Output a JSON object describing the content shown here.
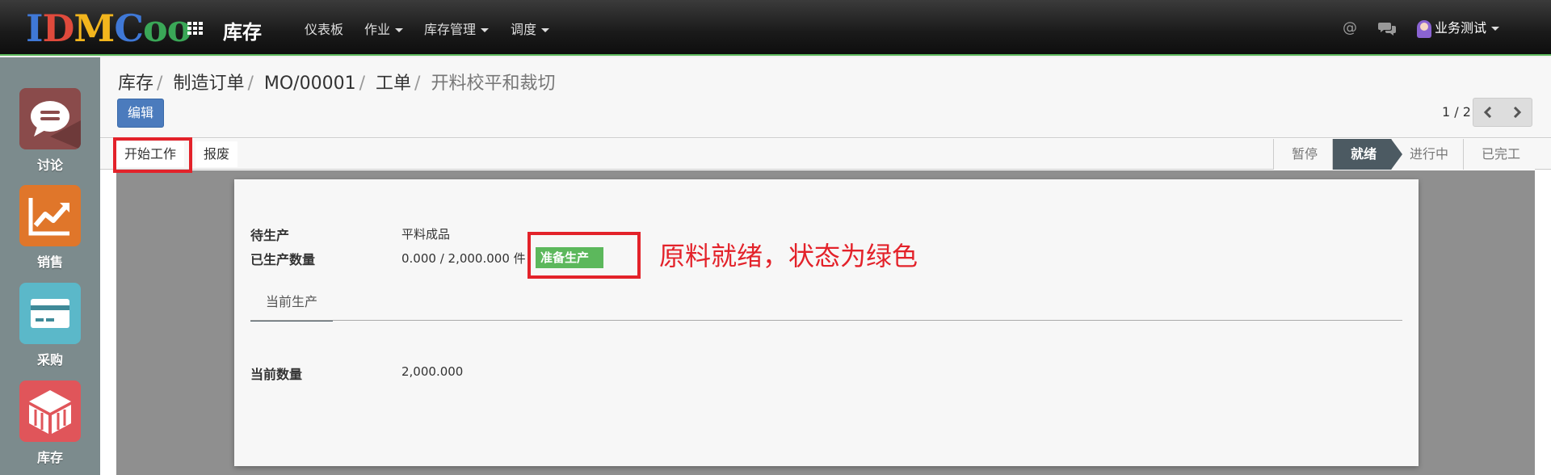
{
  "topbar": {
    "logo_letters": [
      "I",
      "D",
      "M",
      "C",
      "o",
      "o"
    ],
    "apps_icon": "grid-icon",
    "app_title": "库存",
    "menu": [
      {
        "label": "仪表板",
        "dropdown": false
      },
      {
        "label": "作业",
        "dropdown": true
      },
      {
        "label": "库存管理",
        "dropdown": true
      },
      {
        "label": "调度",
        "dropdown": true
      }
    ],
    "mention_icon": "@",
    "chat_icon": "chat-icon",
    "user_name": "业务测试"
  },
  "sidebar": {
    "items": [
      {
        "label": "讨论",
        "icon": "chat-bubble-icon",
        "color": "#8a4b4b"
      },
      {
        "label": "销售",
        "icon": "trend-chart-icon",
        "color": "#e0762a"
      },
      {
        "label": "采购",
        "icon": "credit-card-icon",
        "color": "#5bb8c9"
      },
      {
        "label": "库存",
        "icon": "warehouse-icon",
        "color": "#e0555a"
      }
    ]
  },
  "breadcrumb": {
    "items": [
      "库存",
      "制造订单",
      "MO/00001",
      "工单"
    ],
    "current": "开料校平和裁切"
  },
  "toolbar": {
    "edit_label": "编辑",
    "pager": "1 / 2"
  },
  "statusbar": {
    "buttons": [
      "开始工作",
      "报废"
    ],
    "stages": [
      "暂停",
      "就绪",
      "进行中",
      "已完工"
    ],
    "current_stage": "就绪"
  },
  "form": {
    "to_produce_label": "待生产",
    "to_produce_value": "平料成品",
    "produced_qty_label": "已生产数量",
    "produced_qty_value": "0.000 / 2,000.000 件",
    "status_badge": "准备生产",
    "tab_label": "当前生产",
    "current_qty_label": "当前数量",
    "current_qty_value": "2,000.000"
  },
  "annotation": {
    "text": "原料就绪，状态为绿色",
    "color": "#e3222a"
  },
  "colors": {
    "accent_green": "#5cb85c",
    "edit_blue": "#4b7bbd",
    "highlight_red": "#e3222a",
    "stage_current": "#4c5a62"
  }
}
